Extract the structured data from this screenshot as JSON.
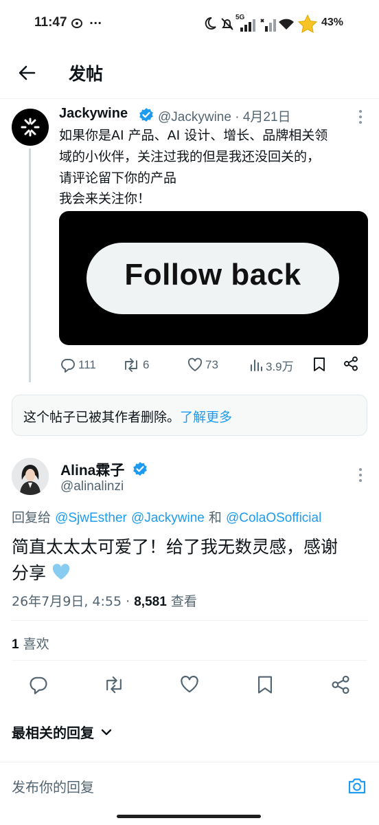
{
  "status_bar": {
    "time": "11:47",
    "network": "5G",
    "battery": "43%"
  },
  "header": {
    "title": "发帖"
  },
  "parent_tweet": {
    "name": "Jackywine",
    "handle_date": "@Jackywine · 4月21日",
    "text_lines": [
      "如果你是AI 产品、AI 设计、增长、品牌相关领",
      "域的小伙伴，关注过我的但是我还没回关的，",
      "请评论留下你的产品",
      "我会来关注你！"
    ],
    "media_text": "Follow back",
    "replies": "111",
    "reposts": "6",
    "likes": "73",
    "views": "3.9万"
  },
  "deleted_notice": {
    "text": "这个帖子已被其作者删除。",
    "link": "了解更多"
  },
  "reply_tweet": {
    "name": "Alina霖子",
    "handle": "@alinalinzi",
    "reply_to_prefix": "回复给",
    "mention_1": "@SjwEsther",
    "mention_2": "@Jackywine",
    "conjunction": "和",
    "mention_3": "@ColaOSofficial",
    "text_line_1": "简直太太太可爱了！给了我无数灵感，感谢",
    "text_line_2": "分享",
    "timestamp": "26年7月9日, 4:55 · ",
    "view_count": "8,581",
    "view_label": "查看",
    "like_count": "1",
    "like_label": "喜欢"
  },
  "sort": {
    "label": "最相关的回复"
  },
  "composer": {
    "placeholder": "发布你的回复"
  },
  "colors": {
    "accent": "#1d9bf0",
    "text": "#0f1419",
    "secondary": "#536471",
    "verified": "#1d9bf0"
  }
}
